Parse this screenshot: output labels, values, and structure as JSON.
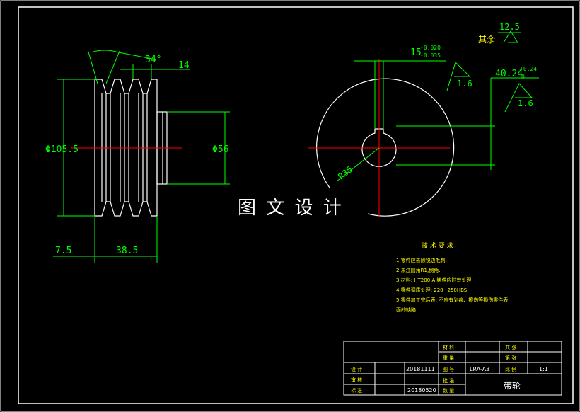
{
  "drawing": {
    "dims": {
      "angle": "34°",
      "groove": "14",
      "dia_outer": "Φ105.5",
      "dia_hub": "Φ56",
      "offset": "7.5",
      "width": "38.5",
      "key_width": "15",
      "key_width_tol_upper": "-0.020",
      "key_width_tol_lower": "-0.035",
      "key_depth": "40.24",
      "key_depth_tol_upper": "+0.24",
      "key_depth_tol_lower": "0",
      "radius": "R35"
    },
    "roughness": {
      "rest_label": "其余",
      "rest_value": "12.5",
      "r1": "1.6",
      "r2": "1.6"
    },
    "watermark": "图 文 设 计",
    "tech_requirements": {
      "title": "技 术 要 求",
      "lines": [
        "1.零件应去除锐边毛刺.",
        "2.未注圆角R1,倒角.",
        "3.材料: HT200-A,铸件应时效处理.",
        "4.零件调质处理: 220~250HBS.",
        "5.零件加工完后表: 不应有划痕、擦伤等损伤零件表",
        "面的缺陷."
      ]
    },
    "title_block": {
      "drawn_label": "设 计",
      "drawn_date": "20181111",
      "check_label": "审 核",
      "check_date": "20180520",
      "std_label": "标 准",
      "approve_label": "批 准",
      "material_label": "材 料",
      "scale_label": "比 例",
      "drawing_no_label": "图 号",
      "drawing_no": "LRA-A3",
      "qty_label": "数 量",
      "qty_value": "1:1",
      "sheet_label": "共 张",
      "sheet2_label": "第 张",
      "part_name": "带轮",
      "weight_label": "重 量"
    }
  },
  "colors": {
    "outline": "#ffffff",
    "dimension": "#00ff00",
    "centerline": "#ff0000",
    "note": "#ffff00",
    "background": "#000000"
  }
}
